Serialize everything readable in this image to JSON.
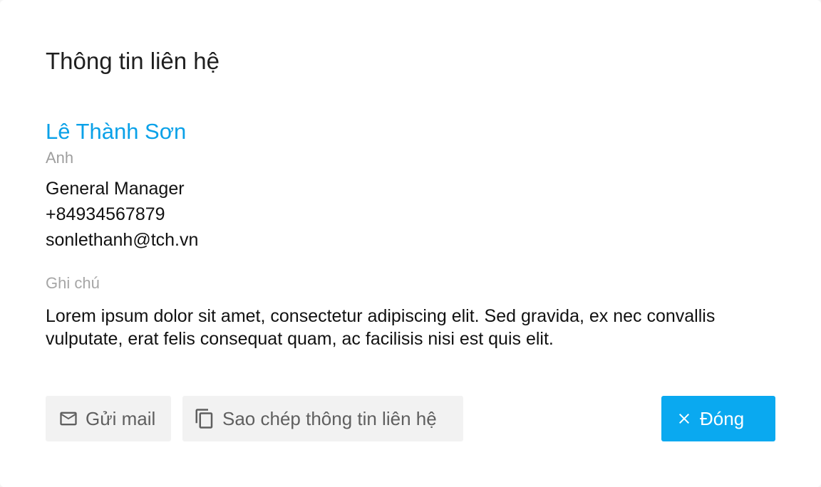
{
  "dialog": {
    "title": "Thông tin liên hệ"
  },
  "contact": {
    "name": "Lê Thành Sơn",
    "salutation": "Anh",
    "position": "General Manager",
    "phone": "+84934567879",
    "email": "sonlethanh@tch.vn"
  },
  "note": {
    "label": "Ghi chú",
    "text": "Lorem ipsum dolor sit amet, consectetur adipiscing elit. Sed gravida, ex nec convallis vulputate, erat felis consequat quam, ac facilisis nisi est quis elit."
  },
  "actions": {
    "send_mail": {
      "label": "Gửi mail",
      "icon": "mail-icon"
    },
    "copy_contact": {
      "label": "Sao chép thông tin liên hệ",
      "icon": "copy-icon"
    },
    "close": {
      "label": "Đóng",
      "icon": "close-icon"
    }
  },
  "colors": {
    "accent": "#0aa9f0",
    "name_color": "#0aa1e8",
    "secondary_button_bg": "#f2f2f2",
    "muted_text": "#9e9e9e"
  }
}
